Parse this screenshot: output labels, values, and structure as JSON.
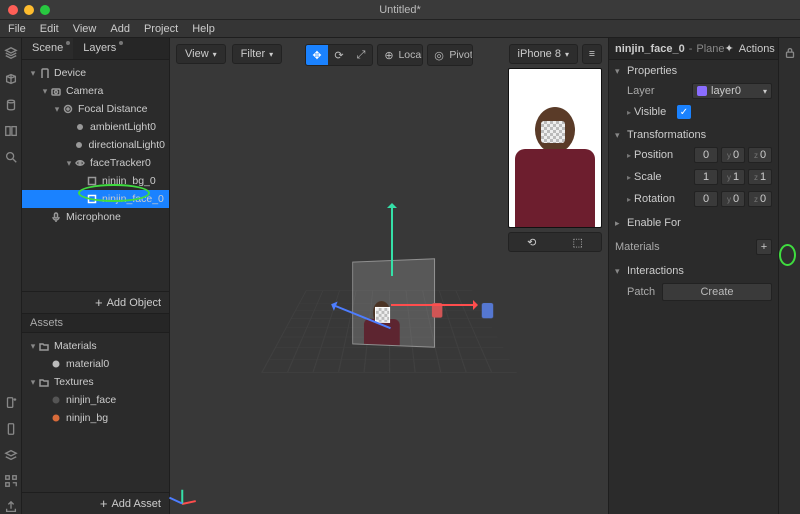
{
  "title": "Untitled*",
  "menu": [
    "File",
    "Edit",
    "View",
    "Add",
    "Project",
    "Help"
  ],
  "rail_left_icons": [
    "layers-icon",
    "cube-icon",
    "cylinder-icon",
    "columns-icon",
    "search-icon"
  ],
  "rail_left_bottom_icons": [
    "phone-plus-icon",
    "device-icon",
    "layers2-icon",
    "qr-icon",
    "share-icon"
  ],
  "left_tabs": {
    "scene": "Scene",
    "layers": "Layers"
  },
  "hierarchy": [
    {
      "d": 0,
      "caret": "▾",
      "icon": "device",
      "label": "Device"
    },
    {
      "d": 1,
      "caret": "▾",
      "icon": "camera",
      "label": "Camera"
    },
    {
      "d": 2,
      "caret": "▾",
      "icon": "focal",
      "label": "Focal Distance"
    },
    {
      "d": 3,
      "caret": "",
      "icon": "light",
      "label": "ambientLight0"
    },
    {
      "d": 3,
      "caret": "",
      "icon": "light",
      "label": "directionalLight0"
    },
    {
      "d": 3,
      "caret": "▾",
      "icon": "eye",
      "label": "faceTracker0"
    },
    {
      "d": 4,
      "caret": "",
      "icon": "plane",
      "label": "ninjin_bg_0"
    },
    {
      "d": 4,
      "caret": "",
      "icon": "plane",
      "label": "ninjin_face_0",
      "sel": true
    },
    {
      "d": 1,
      "caret": "",
      "icon": "mic",
      "label": "Microphone"
    }
  ],
  "add_object": "Add Object",
  "assets_header": "Assets",
  "assets": [
    {
      "d": 0,
      "caret": "▾",
      "icon": "folder",
      "label": "Materials"
    },
    {
      "d": 1,
      "caret": "",
      "icon": "sphere",
      "label": "material0"
    },
    {
      "d": 0,
      "caret": "▾",
      "icon": "folder",
      "label": "Textures"
    },
    {
      "d": 1,
      "caret": "",
      "icon": "tex",
      "label": "ninjin_face"
    },
    {
      "d": 1,
      "caret": "",
      "icon": "tex2",
      "label": "ninjin_bg"
    }
  ],
  "add_asset": "Add Asset",
  "viewport": {
    "view": "View",
    "filter": "Filter",
    "local": "Local",
    "pivot": "Pivot"
  },
  "preview": {
    "device": "iPhone 8"
  },
  "inspector": {
    "name": "ninjin_face_0",
    "type": "Plane",
    "actions": "Actions",
    "sections": {
      "properties": "Properties",
      "transformations": "Transformations",
      "enable_for": "Enable For",
      "materials": "Materials",
      "interactions": "Interactions"
    },
    "props": {
      "layer": "Layer",
      "layer_val": "layer0",
      "visible": "Visible"
    },
    "trans": {
      "position": {
        "label": "Position",
        "x": "0",
        "y": "0",
        "z": "0"
      },
      "scale": {
        "label": "Scale",
        "x": "1",
        "y": "1",
        "z": "1"
      },
      "rotation": {
        "label": "Rotation",
        "x": "0",
        "y": "0",
        "z": "0"
      }
    },
    "patch": "Patch",
    "create": "Create"
  }
}
